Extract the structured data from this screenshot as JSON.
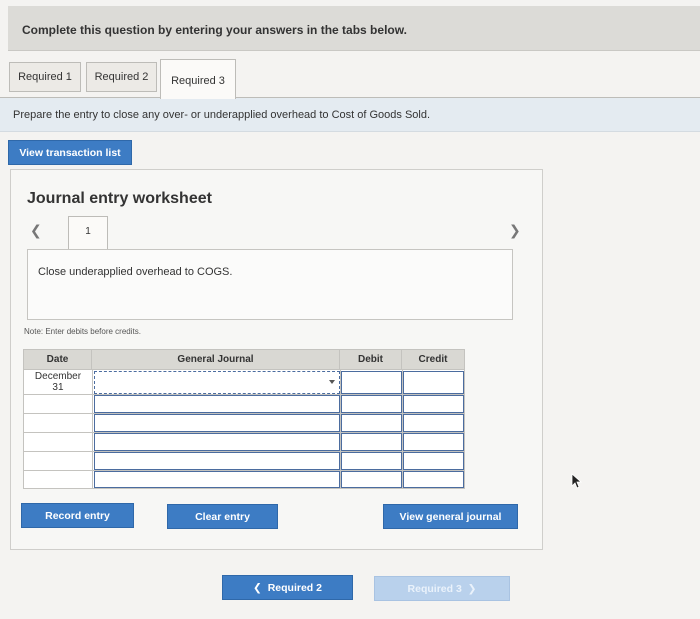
{
  "instruction": "Complete this question by entering your answers in the tabs below.",
  "tabs": [
    {
      "label": "Required 1"
    },
    {
      "label": "Required 2"
    },
    {
      "label": "Required 3"
    }
  ],
  "prompt": "Prepare the entry to close any over- or underapplied overhead to Cost of Goods Sold.",
  "buttons": {
    "view_transactions": "View transaction list",
    "record_entry": "Record entry",
    "clear_entry": "Clear entry",
    "view_general_journal": "View general journal"
  },
  "worksheet": {
    "title": "Journal entry worksheet",
    "entry_number": "1",
    "description": "Close underapplied overhead to COGS.",
    "note": "Note: Enter debits before credits."
  },
  "journal_table": {
    "headers": [
      "Date",
      "General Journal",
      "Debit",
      "Credit"
    ],
    "first_date": "December\n31"
  },
  "footer_nav": {
    "prev_label": "Required 2",
    "next_label": "Required 3"
  },
  "colors": {
    "button_blue": "#3d7cc4",
    "disabled_blue": "#b9d1ec",
    "prompt_bg": "#e4ebf1"
  }
}
